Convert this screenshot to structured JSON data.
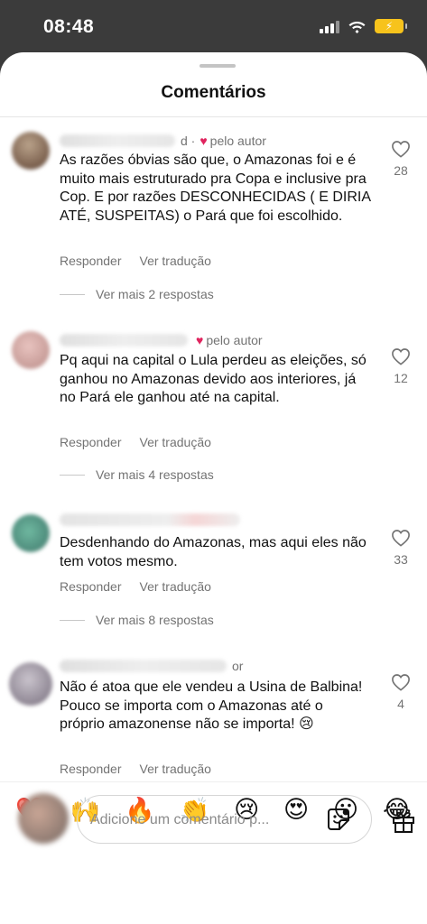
{
  "status": {
    "time": "08:48"
  },
  "sheet": {
    "title": "Comentários"
  },
  "comments": [
    {
      "meta": "d ·",
      "author_badge": "pelo autor",
      "text": "As razões óbvias são que, o Amazonas foi e é muito mais estruturado pra Copa e inclusive pra Cop. E por razões DESCONHECIDAS ( E DIRIA ATÉ, SUSPEITAS) o Pará que foi escolhido.",
      "reply_label": "Responder",
      "translate_label": "Ver tradução",
      "more_replies": "Ver mais 2 respostas",
      "likes": "28"
    },
    {
      "meta": "",
      "author_badge": "pelo autor",
      "text": "Pq aqui na capital o Lula perdeu as eleições, só ganhou no Amazonas devido aos interiores, já no Pará ele ganhou até na capital.",
      "reply_label": "Responder",
      "translate_label": "Ver tradução",
      "more_replies": "Ver mais 4 respostas",
      "likes": "12"
    },
    {
      "meta": "",
      "author_badge": "",
      "text": "Desdenhando do Amazonas, mas aqui eles não tem votos mesmo.",
      "reply_label": "Responder",
      "translate_label": "Ver tradução",
      "more_replies": "Ver mais 8 respostas",
      "likes": "33"
    },
    {
      "meta": "or",
      "author_badge": "",
      "text": "Não é atoa que ele vendeu a Usina de Balbina! Pouco se importa com o Amazonas até o próprio amazonense não se importa! 😢",
      "reply_label": "Responder",
      "translate_label": "Ver tradução",
      "more_replies": "",
      "likes": "4"
    }
  ],
  "reactions": [
    "❤️",
    "🙌",
    "🔥",
    "👏",
    "😢",
    "😍",
    "😮",
    "😂"
  ],
  "composer": {
    "placeholder": "Adicione um comentário p..."
  },
  "icons": {
    "like": "heart-outline-icon",
    "sticker": "sticker-icon",
    "gift": "gift-icon",
    "author_heart": "heart-filled-icon"
  }
}
